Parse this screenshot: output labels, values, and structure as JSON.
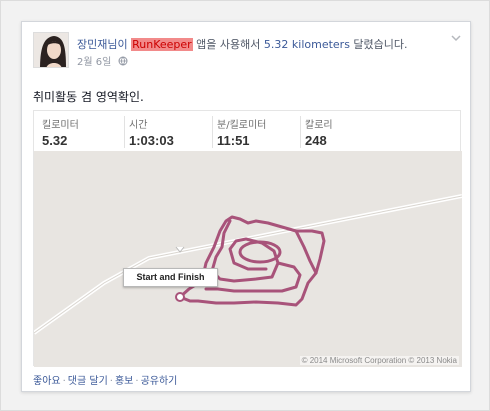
{
  "post": {
    "author": "장민재님이",
    "app_name": "RunKeeper",
    "text_middle": " 앱을 사용해서 ",
    "distance_text": "5.32 kilometers",
    "text_end": " 달렸습니다.",
    "date": "2월 6일",
    "body": "취미활동 겸 영역확인."
  },
  "stats": [
    {
      "label": "킬로미터",
      "value": "5.32"
    },
    {
      "label": "시간",
      "value": "1:03:03"
    },
    {
      "label": "분/킬로미터",
      "value": "11:51"
    },
    {
      "label": "칼로리",
      "value": "248"
    }
  ],
  "map": {
    "marker_label": "Start and Finish",
    "copyright": "© 2014 Microsoft Corporation © 2013 Nokia",
    "route_color": "#a8537a"
  },
  "actions": {
    "like": "좋아요",
    "comment": "댓글 달기",
    "promote": "홍보",
    "share": "공유하기"
  },
  "icons": [
    "chevron-down-icon",
    "globe-icon"
  ]
}
